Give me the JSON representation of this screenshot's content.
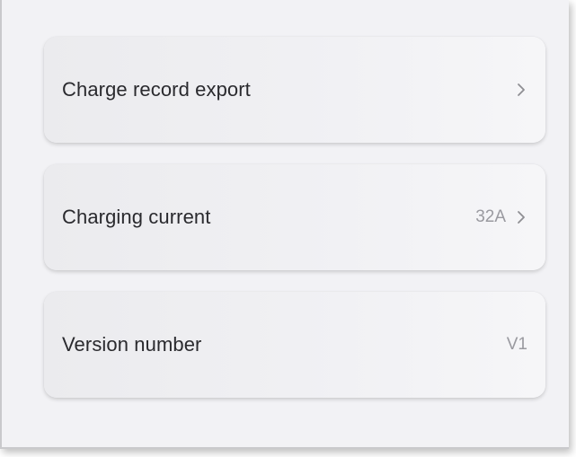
{
  "settings": {
    "items": [
      {
        "label": "Charge record export",
        "value": "",
        "has_chevron": true
      },
      {
        "label": "Charging current",
        "value": "32A",
        "has_chevron": true
      },
      {
        "label": "Version number",
        "value": "V1",
        "has_chevron": false
      }
    ]
  },
  "icons": {
    "chevron": "chevron-right-icon"
  },
  "colors": {
    "background": "#f2f2f5",
    "card": "#efeff2",
    "label_text": "#2a2a2e",
    "value_text": "#9a9aa0",
    "chevron": "#8e8e93"
  }
}
